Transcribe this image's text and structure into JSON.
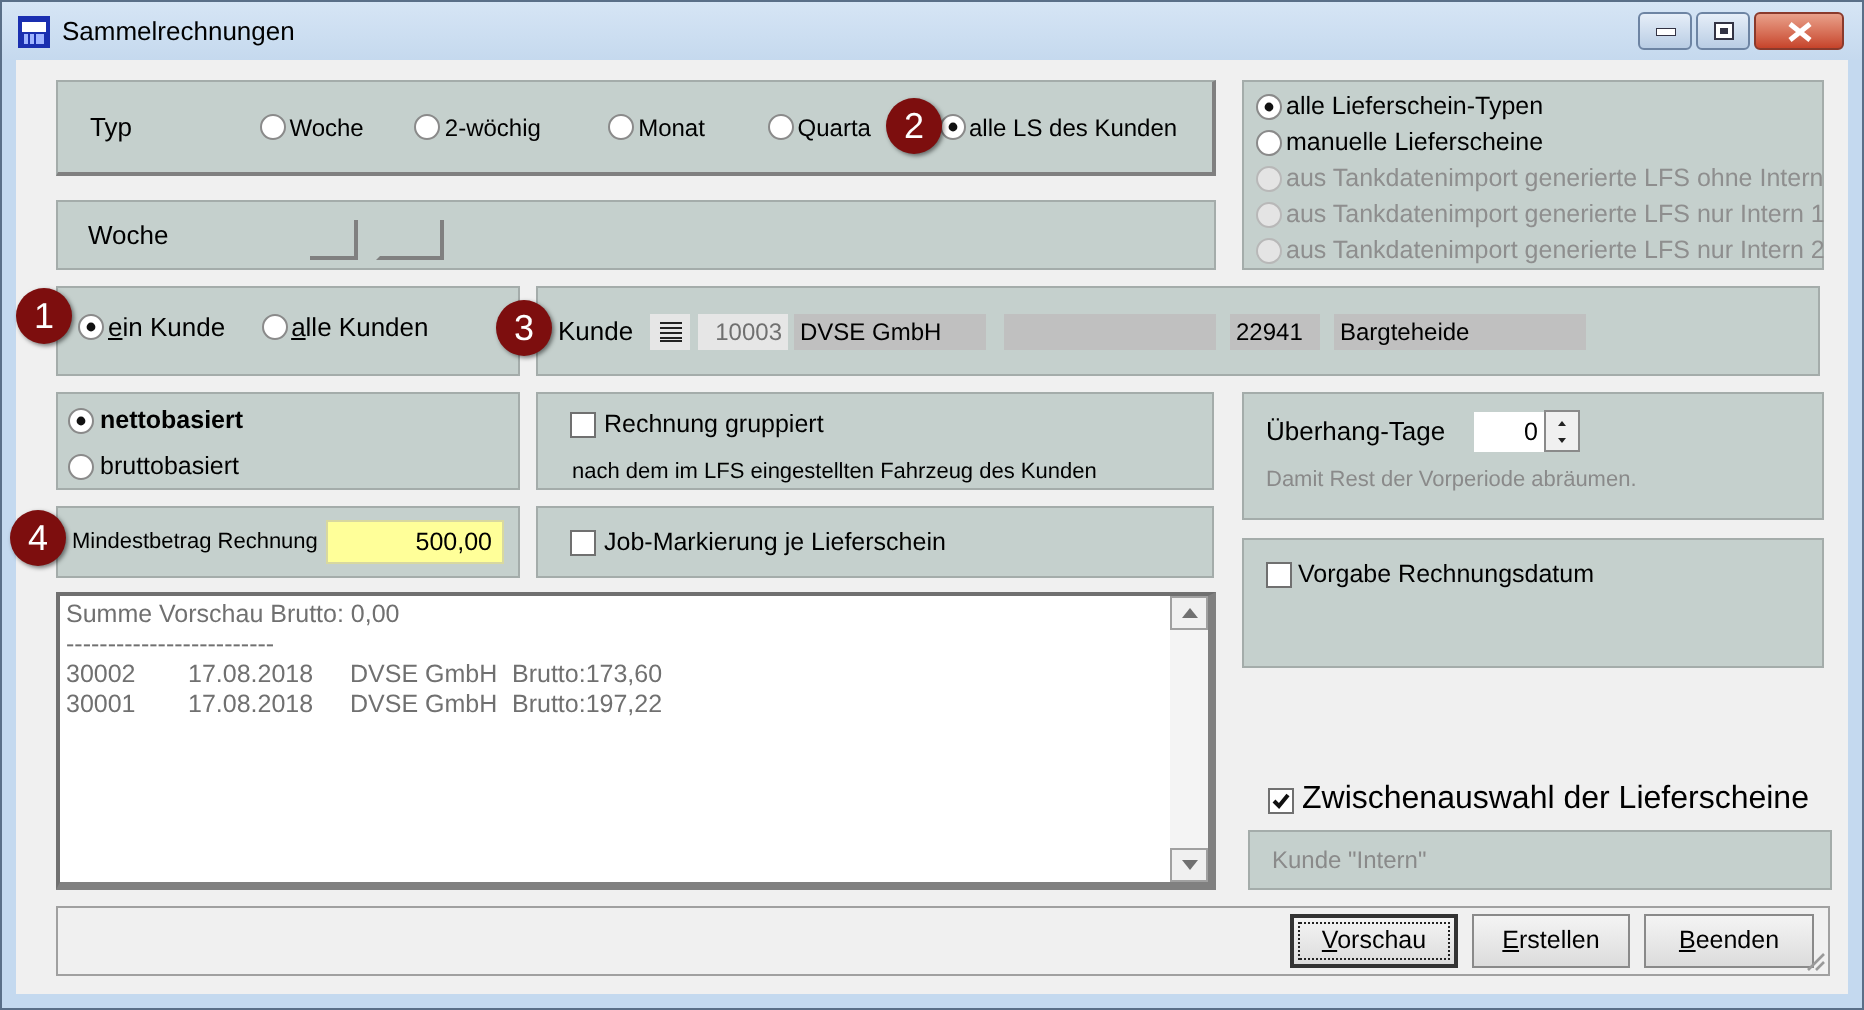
{
  "window": {
    "title": "Sammelrechnungen"
  },
  "typ": {
    "label": "Typ",
    "marker": "2",
    "options": [
      {
        "label": "Woche",
        "selected": false
      },
      {
        "label": "2-wöchig",
        "selected": false
      },
      {
        "label": "Monat",
        "selected": false
      },
      {
        "label": "Quarta",
        "selected": false
      },
      {
        "label": "alle LS des Kunden",
        "selected": true
      }
    ]
  },
  "ls_types": [
    {
      "label": "alle Lieferschein-Typen",
      "selected": true,
      "disabled": false
    },
    {
      "label": "manuelle Lieferscheine",
      "selected": false,
      "disabled": false
    },
    {
      "label": "aus Tankdatenimport generierte LFS ohne Intern",
      "selected": false,
      "disabled": true
    },
    {
      "label": "aus Tankdatenimport generierte LFS nur Intern 1",
      "selected": false,
      "disabled": true
    },
    {
      "label": "aus Tankdatenimport generierte LFS nur Intern 2",
      "selected": false,
      "disabled": true
    }
  ],
  "woche": {
    "label": "Woche"
  },
  "kunden_scope": {
    "marker": "1",
    "options": [
      {
        "label": "ein Kunde",
        "selected": true,
        "mnemonic": true
      },
      {
        "label": "alle Kunden",
        "selected": false,
        "mnemonic": true
      }
    ]
  },
  "kunde": {
    "marker": "3",
    "label": "Kunde",
    "number": "10003",
    "name": "DVSE GmbH",
    "zip": "22941",
    "city": "Bargteheide"
  },
  "basis": [
    {
      "label": "nettobasiert",
      "selected": true
    },
    {
      "label": "bruttobasiert",
      "selected": false
    }
  ],
  "gruppiert": {
    "label": "Rechnung gruppiert",
    "checked": false,
    "note": "nach dem im LFS eingestellten Fahrzeug des Kunden"
  },
  "mindestbetrag": {
    "marker": "4",
    "label": "Mindestbetrag Rechnung",
    "value": "500,00"
  },
  "job_markierung": {
    "label": "Job-Markierung je Lieferschein",
    "checked": false
  },
  "ueberhang": {
    "label": "Überhang-Tage",
    "value": "0",
    "hint": "Damit Rest der Vorperiode abräumen."
  },
  "vorgabe_datum": {
    "label": "Vorgabe Rechnungsdatum",
    "checked": false
  },
  "preview": {
    "lines": [
      "Summe Vorschau Brutto: 0,00",
      "-------------------------"
    ],
    "rows": [
      {
        "number": "30002",
        "date": "17.08.2018",
        "customer": "DVSE GmbH",
        "amount": "Brutto:173,60"
      },
      {
        "number": "30001",
        "date": "17.08.2018",
        "customer": "DVSE GmbH",
        "amount": "Brutto:197,22"
      }
    ]
  },
  "zwischenauswahl": {
    "label": "Zwischenauswahl der Lieferscheine",
    "checked": true
  },
  "kunde_intern": {
    "label": "Kunde \"Intern\""
  },
  "buttons": [
    {
      "label": "Vorschau",
      "mnemonic": true,
      "focused": true
    },
    {
      "label": "Erstellen",
      "mnemonic": true,
      "focused": false
    },
    {
      "label": "Beenden",
      "mnemonic": true,
      "focused": false
    }
  ]
}
